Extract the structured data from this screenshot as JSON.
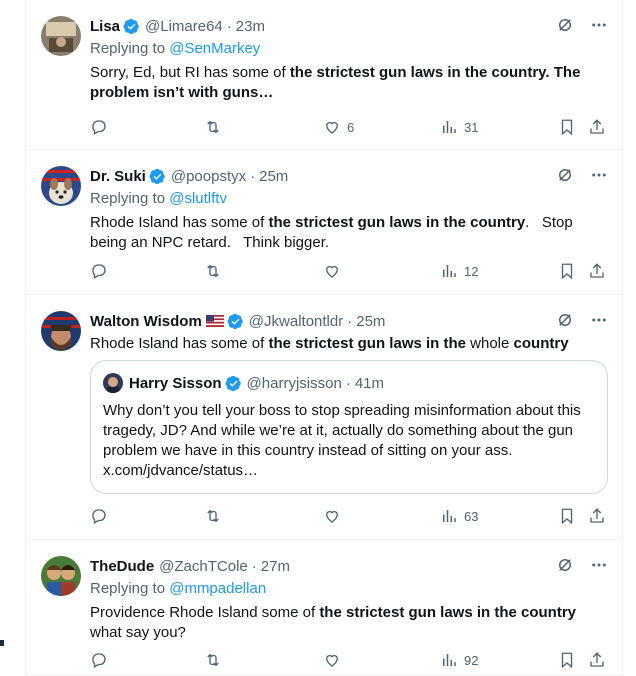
{
  "colors": {
    "accent": "#1d9bf0",
    "muted": "#536471",
    "text": "#0f1419",
    "border": "#eff3f4"
  },
  "icons": {
    "reply": "reply-icon",
    "retweet": "retweet-icon",
    "like": "heart-icon",
    "views": "views-icon",
    "bookmark": "bookmark-icon",
    "share": "share-icon",
    "grok": "grok-icon",
    "more": "more-icon",
    "verified": "verified-badge-icon"
  },
  "tweets": [
    {
      "name": "Lisa",
      "handle": "@Limare64",
      "time": "23m",
      "replying_prefix": "Replying to ",
      "replying_to": "@SenMarkey",
      "text_parts": [
        "Sorry, Ed, but RI has some of ",
        "the strictest gun laws in the country. The problem isn’t with guns…"
      ],
      "likes": "6",
      "views": "31"
    },
    {
      "name": "Dr. Suki",
      "handle": "@poopstyx",
      "time": "25m",
      "replying_prefix": "Replying to ",
      "replying_to": "@slutlftv",
      "text_parts": [
        "Rhode Island has some of ",
        "the strictest gun laws in the country",
        ".   Stop being an NPC retard.   Think bigger."
      ],
      "likes": "",
      "views": "12"
    },
    {
      "name": "Walton Wisdom",
      "flag": "🇺🇸",
      "handle": "@Jkwaltontldr",
      "time": "25m",
      "text_parts": [
        "Rhode Island has some of ",
        "the strictest gun laws in the",
        " whole ",
        "country"
      ],
      "quote": {
        "name": "Harry Sisson",
        "handle": "@harryjsisson",
        "time": "41m",
        "text": "Why don’t you tell your boss to stop spreading misinformation about this tragedy, JD? And while we’re at it, actually do something about the gun problem we have in this country instead of sitting on your ass. x.com/jdvance/status…"
      },
      "likes": "",
      "views": "63"
    },
    {
      "name": "TheDude",
      "handle": "@ZachTCole",
      "time": "27m",
      "replying_prefix": "Replying to ",
      "replying_to": "@mmpadellan",
      "text_parts": [
        "Providence Rhode Island some of ",
        "the strictest gun laws in the country",
        " what say you?"
      ],
      "likes": "",
      "views": "92"
    }
  ]
}
